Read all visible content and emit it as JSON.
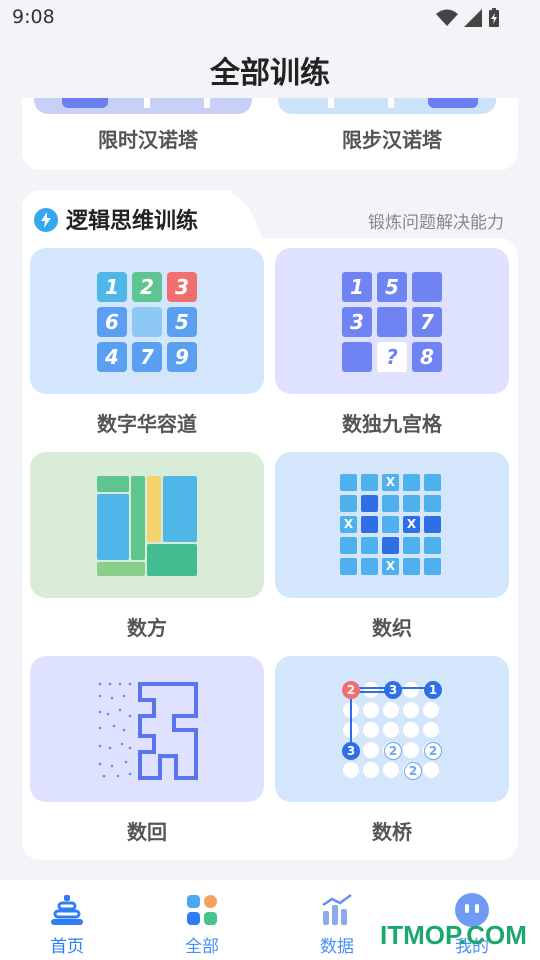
{
  "status": {
    "time": "9:08"
  },
  "header": {
    "title": "全部训练"
  },
  "previous_section": {
    "items": [
      {
        "label": "限时汉诺塔"
      },
      {
        "label": "限步汉诺塔"
      }
    ]
  },
  "section": {
    "icon": "lightning-icon",
    "title": "逻辑思维训练",
    "subtitle": "锻炼问题解决能力",
    "games": [
      {
        "label": "数字华容道",
        "thumb_color": "#d3e6fb"
      },
      {
        "label": "数独九宫格",
        "thumb_color": "#dfe2ff"
      },
      {
        "label": "数方",
        "thumb_color": "#d9ecd8"
      },
      {
        "label": "数织",
        "thumb_color": "#d3e6fb"
      },
      {
        "label": "数回",
        "thumb_color": "#dfe2ff"
      },
      {
        "label": "数桥",
        "thumb_color": "#d3e6fb"
      }
    ],
    "puzzle_digits": {
      "klotski": [
        "1",
        "2",
        "3",
        "6",
        "5",
        "4",
        "7",
        "9"
      ],
      "sudoku": [
        "1",
        "5",
        "3",
        "7",
        "?",
        "8"
      ],
      "nonogram_mark": "X",
      "bridges": [
        "2",
        "3",
        "1",
        "3",
        "2",
        "2",
        "2"
      ]
    }
  },
  "bottom_nav": {
    "items": [
      {
        "label": "首页",
        "icon": "pagoda-icon"
      },
      {
        "label": "全部",
        "icon": "grid-icon"
      },
      {
        "label": "数据",
        "icon": "chart-icon"
      },
      {
        "label": "我的",
        "icon": "profile-icon"
      }
    ]
  },
  "watermark": "ITMOP.COM",
  "colors": {
    "accent": "#2f7df6",
    "section_icon": "#33a8f0"
  }
}
